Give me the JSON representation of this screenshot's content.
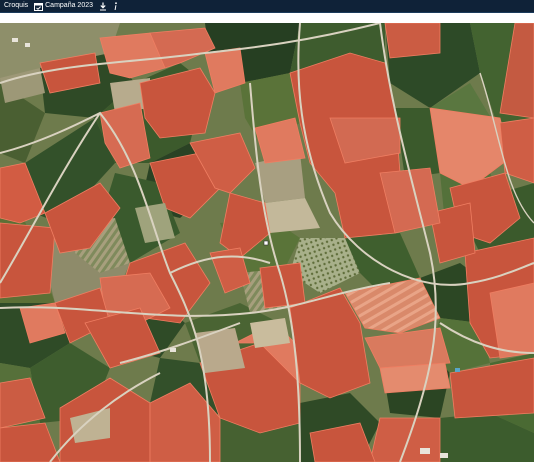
{
  "toolbar": {
    "croquis_label": "Croquis",
    "campaign_label": "Campaña 2023",
    "icons": [
      "calendar-icon",
      "download-icon",
      "info-icon"
    ]
  },
  "map": {
    "layer": "satellite-orthophoto",
    "colors": {
      "highlight_parcel": "#c8553d",
      "highlight_light": "#e07a5f",
      "highlight_edge": "#ef7e62",
      "crop_dark": "#2f4a26",
      "crop_mid": "#4f6a38",
      "soil": "#b9a98c",
      "road": "#d9d2c0"
    }
  }
}
